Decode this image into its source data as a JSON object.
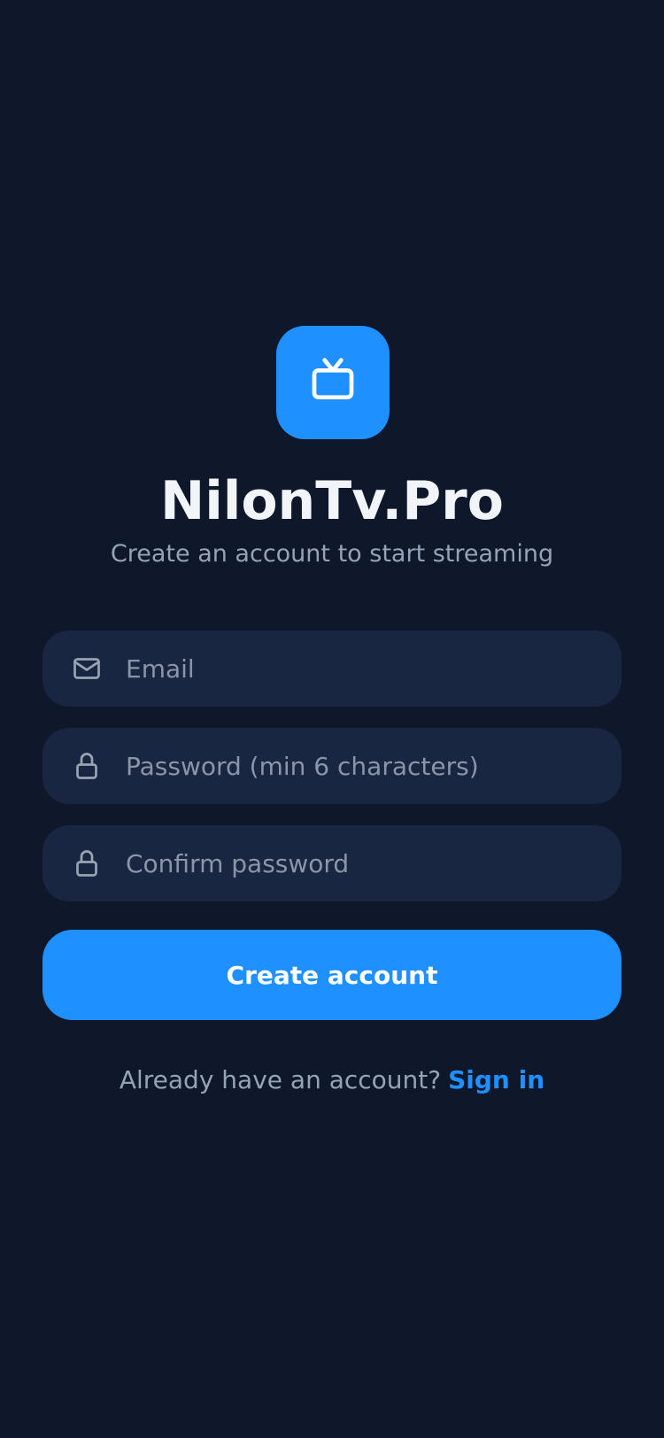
{
  "app": {
    "name": "NilonTv.Pro",
    "subtitle": "Create an account to start streaming",
    "logo_icon": "tv-icon"
  },
  "form": {
    "email": {
      "icon": "mail-icon",
      "placeholder": "Email",
      "value": ""
    },
    "password": {
      "icon": "lock-icon",
      "placeholder": "Password (min 6 characters)",
      "value": ""
    },
    "confirm_password": {
      "icon": "lock-icon",
      "placeholder": "Confirm password",
      "value": ""
    },
    "submit_label": "Create account"
  },
  "footer": {
    "prompt": "Already have an account?",
    "link_label": "Sign in"
  },
  "colors": {
    "background": "#0f172a",
    "accent": "#1e90ff",
    "field_background": "#182641",
    "title_text": "#f1f5f9",
    "muted_text": "#94a3b8"
  }
}
